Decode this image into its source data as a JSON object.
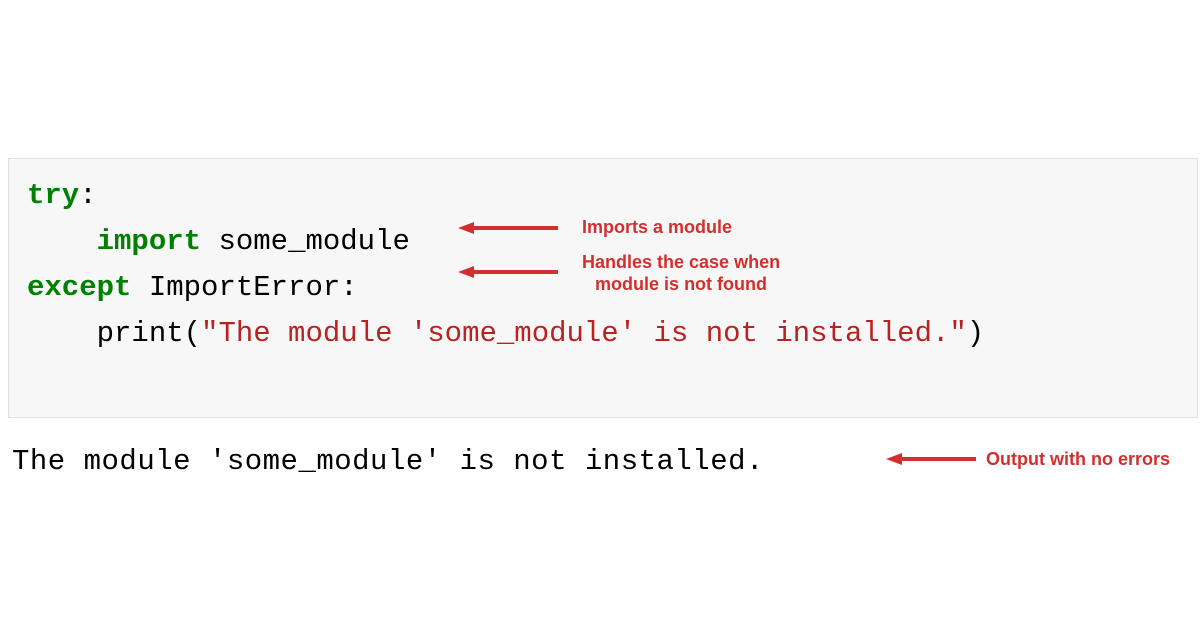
{
  "code": {
    "line1": {
      "keyword": "try",
      "colon": ":"
    },
    "line2": {
      "indent": "    ",
      "keyword": "import",
      "space": " ",
      "module": "some_module"
    },
    "line3": {
      "keyword": "except",
      "space": " ",
      "error": "ImportError:"
    },
    "line4": {
      "indent": "    ",
      "func": "print(",
      "string": "\"The module 'some_module' is not installed.\"",
      "close": ")"
    }
  },
  "output": "The module 'some_module' is not installed.",
  "annotations": {
    "a1": "Imports a module",
    "a2_line1": "Handles the case when",
    "a2_line2": "module is not found",
    "a3": "Output with no errors"
  }
}
